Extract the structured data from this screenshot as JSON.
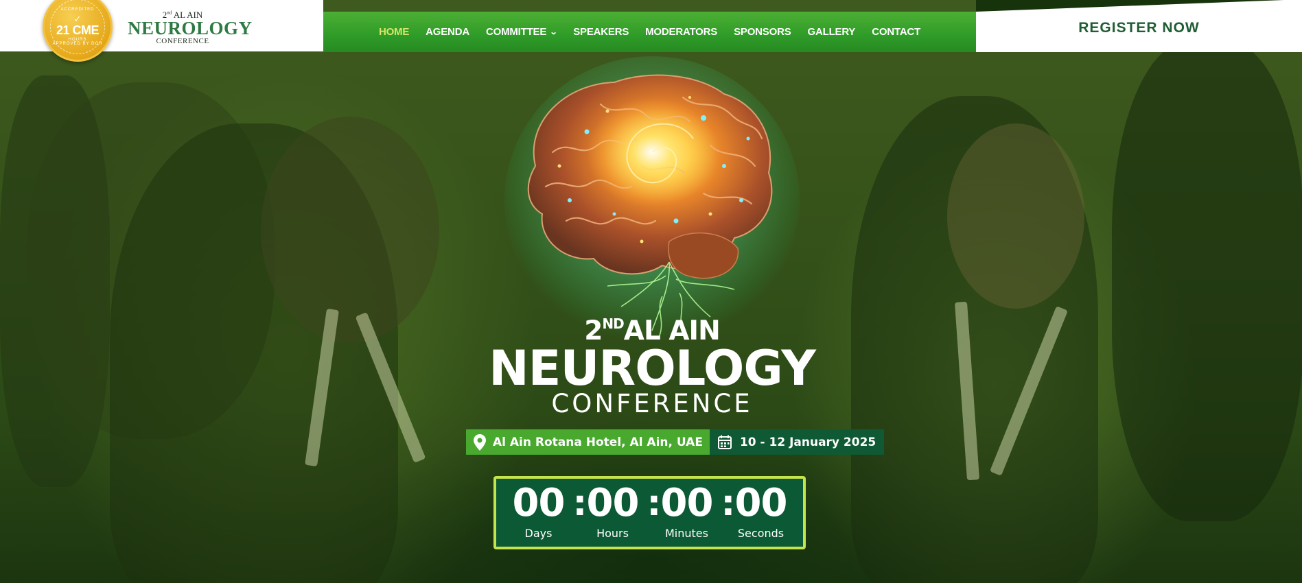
{
  "logo": {
    "badge_value": "21 CME",
    "badge_top": "ACCREDITED",
    "badge_mid": "HOURS",
    "badge_bottom": "APPROVED BY DOH",
    "edition": "2",
    "edition_suffix": "nd",
    "city": "AL AIN",
    "name": "NEUROLOGY",
    "subtitle": "CONFERENCE"
  },
  "nav": {
    "items": [
      {
        "label": "HOME",
        "active": true
      },
      {
        "label": "AGENDA"
      },
      {
        "label": "COMMITTEE"
      },
      {
        "label": "SPEAKERS"
      },
      {
        "label": "MODERATORS"
      },
      {
        "label": "SPONSORS"
      },
      {
        "label": "GALLERY"
      },
      {
        "label": "CONTACT"
      }
    ],
    "dropdown_icon": "chevron-down-icon"
  },
  "register": {
    "label": "REGISTER NOW"
  },
  "hero": {
    "edition": "2",
    "edition_suffix": "ND",
    "city": "AL AIN",
    "title": "NEUROLOGY",
    "subtitle": "CONFERENCE",
    "location": "Al Ain Rotana Hotel, Al Ain, UAE",
    "location_icon": "map-pin-icon",
    "dates": "10 - 12 January 2025",
    "date_icon": "calendar-icon"
  },
  "countdown": {
    "days": "00",
    "hours": "00",
    "minutes": "00",
    "seconds": "00",
    "days_label": "Days",
    "hours_label": "Hours",
    "minutes_label": "Minutes",
    "seconds_label": "Seconds",
    "separator": ":"
  },
  "colors": {
    "nav_green": "#2f9b28",
    "active_nav": "#d9e86a",
    "register_text": "#1f5d32",
    "location_green": "#49a92e",
    "date_dark_green": "#0f5a34",
    "countdown_bg": "#0c5a35",
    "countdown_border": "#c5e34b"
  }
}
